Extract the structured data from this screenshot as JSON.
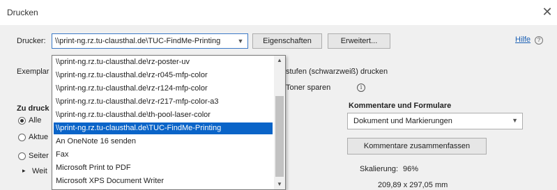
{
  "window": {
    "title": "Drucken",
    "close_glyph": "✕"
  },
  "printer": {
    "label": "Drucker:",
    "selected": "\\\\print-ng.rz.tu-clausthal.de\\TUC-FindMe-Printing",
    "properties_btn": "Eigenschaften",
    "advanced_btn": "Erweitert...",
    "help_link": "Hilfe",
    "help_icon": "?"
  },
  "copies": {
    "label_partial": "Exemplar"
  },
  "options": {
    "grayscale_partial": "stufen (schwarzweiß) drucken",
    "toner_partial": "Toner sparen",
    "info_icon": "i"
  },
  "range": {
    "heading_partial": "Zu druck",
    "all_label": "Alle",
    "current_partial": "Aktue",
    "pages_partial": "Seiter",
    "more_partial": "Weit",
    "more_glyph": "▸"
  },
  "comments": {
    "heading": "Kommentare und Formulare",
    "select_value": "Dokument und Markierungen",
    "summarize_btn": "Kommentare zusammenfassen"
  },
  "scaling": {
    "label": "Skalierung:",
    "value": "96%",
    "size": "209,89 x 297,05 mm"
  },
  "dropdown": {
    "items": [
      "\\\\print-ng.rz.tu-clausthal.de\\rz-poster-uv",
      "\\\\print-ng.rz.tu-clausthal.de\\rz-r045-mfp-color",
      "\\\\print-ng.rz.tu-clausthal.de\\rz-r124-mfp-color",
      "\\\\print-ng.rz.tu-clausthal.de\\rz-r217-mfp-color-a3",
      "\\\\print-ng.rz.tu-clausthal.de\\th-pool-laser-color",
      "\\\\print-ng.rz.tu-clausthal.de\\TUC-FindMe-Printing",
      "An OneNote 16 senden",
      "Fax",
      "Microsoft Print to PDF",
      "Microsoft XPS Document Writer"
    ],
    "selected_index": 5
  },
  "colors": {
    "selection": "#0a64c8",
    "link": "#1a5fb4"
  }
}
